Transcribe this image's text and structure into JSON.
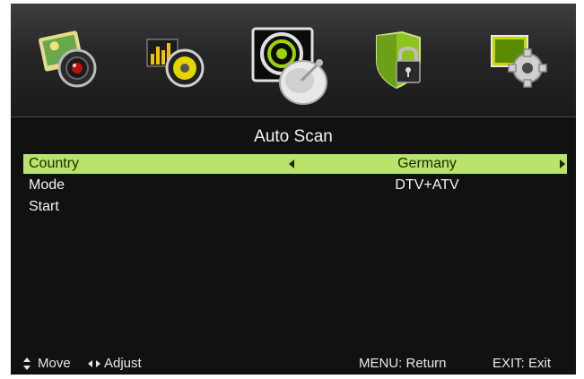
{
  "menu_bar": {
    "icons": [
      {
        "name": "picture-icon",
        "active": false
      },
      {
        "name": "sound-icon",
        "active": false
      },
      {
        "name": "channel-icon",
        "active": true
      },
      {
        "name": "lock-icon",
        "active": false
      },
      {
        "name": "setup-icon",
        "active": false
      }
    ]
  },
  "panel": {
    "title": "Auto Scan",
    "rows": [
      {
        "label": "Country",
        "value": "Germany",
        "selected": true
      },
      {
        "label": "Mode",
        "value": "DTV+ATV",
        "selected": false
      },
      {
        "label": "Start",
        "value": "",
        "selected": false
      }
    ]
  },
  "footer": {
    "move_label": "Move",
    "adjust_label": "Adjust",
    "menu_label": "MENU: Return",
    "exit_label": "EXIT: Exit"
  },
  "colors": {
    "background": "#111111",
    "highlight": "#b9e36a",
    "text": "#f4f4f4"
  }
}
